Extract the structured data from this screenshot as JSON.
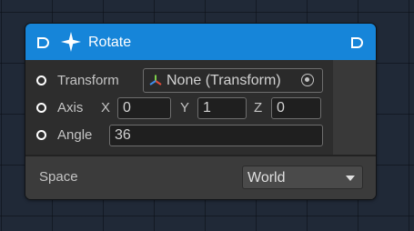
{
  "node": {
    "title": "Rotate",
    "icon": "sparkle-icon",
    "header_color": "#1685d9",
    "flow_input_icon": "flow-input-port-icon",
    "flow_output_icon": "flow-output-port-icon"
  },
  "inputs": {
    "transform": {
      "label": "Transform",
      "value": "None (Transform)",
      "type_icon": "transform-axes-icon",
      "picker_icon": "object-picker-icon"
    },
    "axis": {
      "label": "Axis",
      "x_label": "X",
      "x_value": "0",
      "y_label": "Y",
      "y_value": "1",
      "z_label": "Z",
      "z_value": "0"
    },
    "angle": {
      "label": "Angle",
      "value": "36"
    }
  },
  "settings": {
    "space_label": "Space",
    "space_value": "World"
  }
}
